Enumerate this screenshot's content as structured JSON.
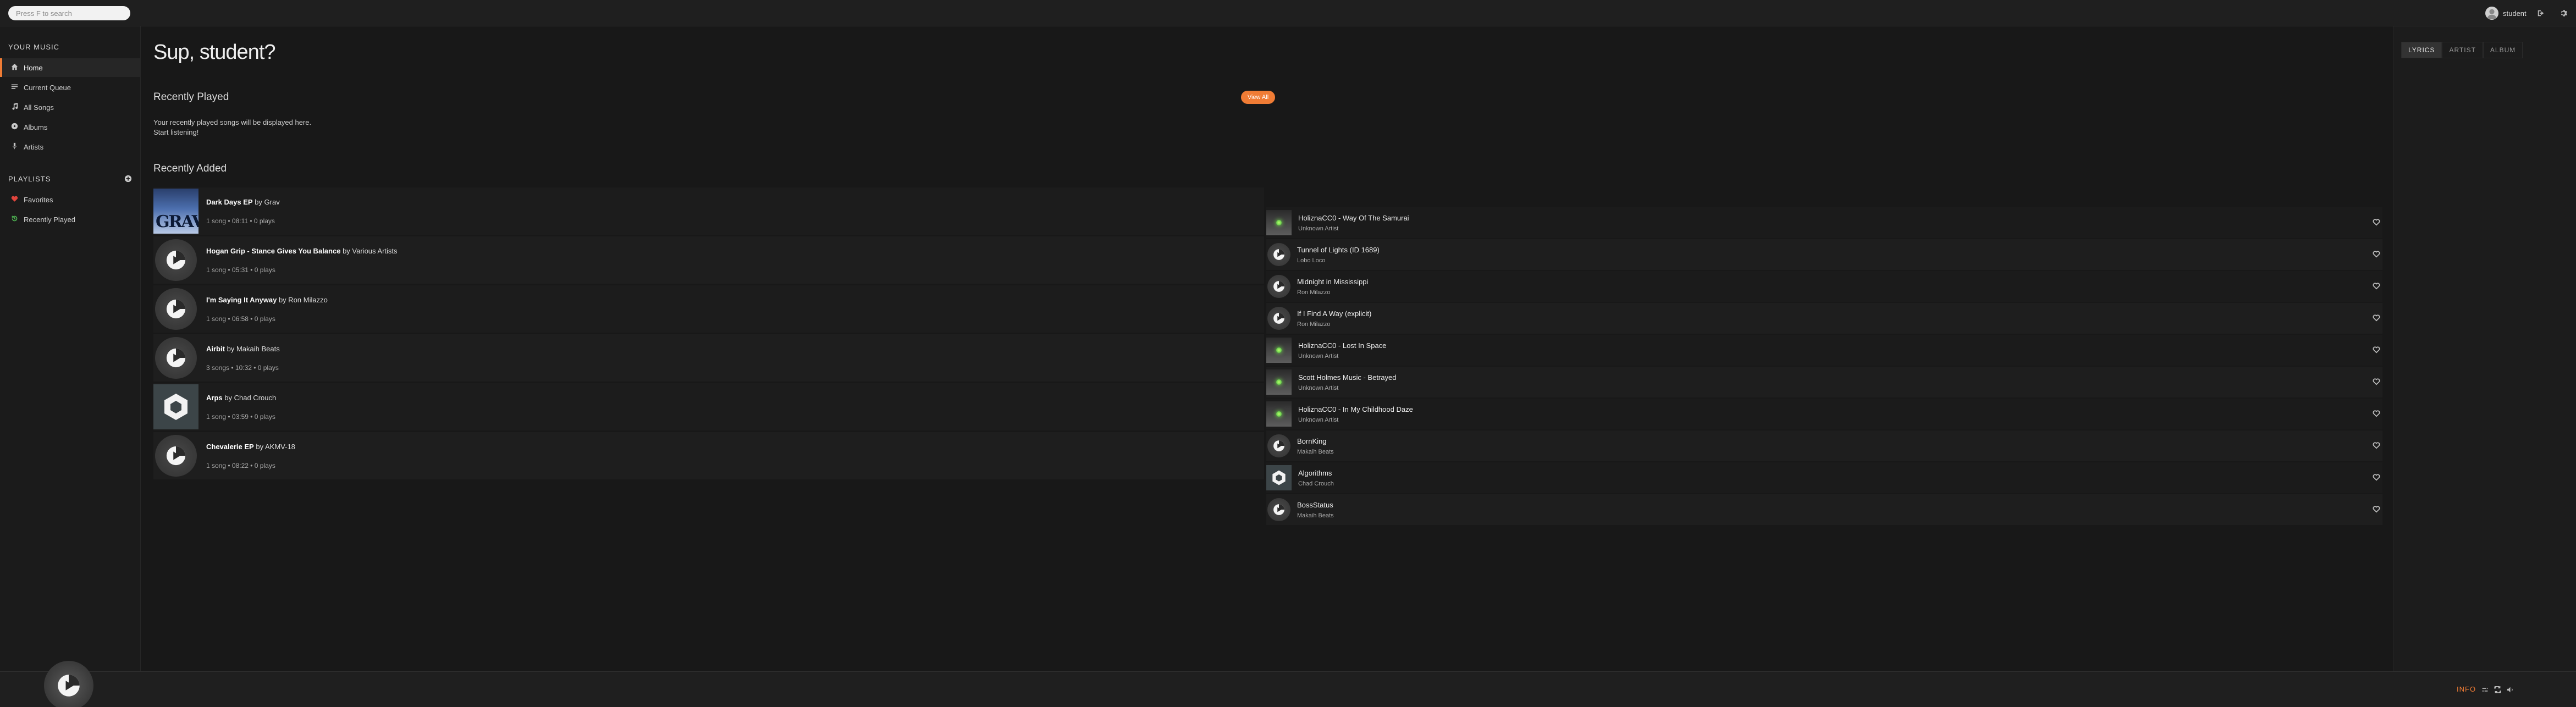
{
  "search": {
    "placeholder": "Press F to search"
  },
  "user": {
    "name": "student"
  },
  "sidebar": {
    "your_music_heading": "YOUR MUSIC",
    "items": [
      {
        "label": "Home",
        "icon": "home-icon"
      },
      {
        "label": "Current Queue",
        "icon": "queue-icon"
      },
      {
        "label": "All Songs",
        "icon": "note-icon"
      },
      {
        "label": "Albums",
        "icon": "disc-icon"
      },
      {
        "label": "Artists",
        "icon": "mic-icon"
      }
    ],
    "playlists_heading": "PLAYLISTS",
    "playlists": [
      {
        "label": "Favorites",
        "icon": "heart-icon"
      },
      {
        "label": "Recently Played",
        "icon": "history-icon"
      }
    ]
  },
  "main": {
    "greeting": "Sup, student?",
    "recently_played_title": "Recently Played",
    "view_all_label": "View All",
    "recent_empty_line1": "Your recently played songs will be displayed here.",
    "recent_empty_line2": "Start listening!",
    "recently_added_title": "Recently Added",
    "by": "by",
    "albums": [
      {
        "title": "Dark Days EP",
        "artist": "Grav",
        "meta": "1 song • 08:11 • 0 plays",
        "thumb": "art"
      },
      {
        "title": "Hogan Grip - Stance Gives You Balance",
        "artist": "Various Artists",
        "meta": "1 song • 05:31 • 0 plays",
        "thumb": "disc"
      },
      {
        "title": "I'm Saying It Anyway",
        "artist": "Ron Milazzo",
        "meta": "1 song • 06:58 • 0 plays",
        "thumb": "disc"
      },
      {
        "title": "Airbit",
        "artist": "Makaih Beats",
        "meta": "3 songs • 10:32 • 0 plays",
        "thumb": "disc"
      },
      {
        "title": "Arps",
        "artist": "Chad Crouch",
        "meta": "1 song • 03:59 • 0 plays",
        "thumb": "hex"
      },
      {
        "title": "Chevalerie EP",
        "artist": "AKMV-18",
        "meta": "1 song • 08:22 • 0 plays",
        "thumb": "disc"
      }
    ],
    "art_text": "GRAV",
    "songs": [
      {
        "title": "HoliznaCC0 - Way Of The Samurai",
        "artist": "Unknown Artist",
        "thumb": "green"
      },
      {
        "title": "Tunnel of Lights (ID 1689)",
        "artist": "Lobo Loco",
        "thumb": "disc"
      },
      {
        "title": "Midnight in Mississippi",
        "artist": "Ron Milazzo",
        "thumb": "disc"
      },
      {
        "title": "If I Find A Way (explicit)",
        "artist": "Ron Milazzo",
        "thumb": "disc"
      },
      {
        "title": "HoliznaCC0 - Lost In Space",
        "artist": "Unknown Artist",
        "thumb": "green"
      },
      {
        "title": "Scott Holmes Music - Betrayed",
        "artist": "Unknown Artist",
        "thumb": "green"
      },
      {
        "title": "HoliznaCC0 - In My Childhood Daze",
        "artist": "Unknown Artist",
        "thumb": "green"
      },
      {
        "title": "BornKing",
        "artist": "Makaih Beats",
        "thumb": "disc"
      },
      {
        "title": "Algorithms",
        "artist": "Chad Crouch",
        "thumb": "hex"
      },
      {
        "title": "BossStatus",
        "artist": "Makaih Beats",
        "thumb": "disc"
      }
    ]
  },
  "right_panel": {
    "tabs": [
      "LYRICS",
      "ARTIST",
      "ALBUM"
    ],
    "active_tab": "LYRICS"
  },
  "player": {
    "info_label": "INFO"
  },
  "colors": {
    "accent": "#f07c35",
    "favorite": "#e0443c",
    "history": "#4caf50"
  }
}
